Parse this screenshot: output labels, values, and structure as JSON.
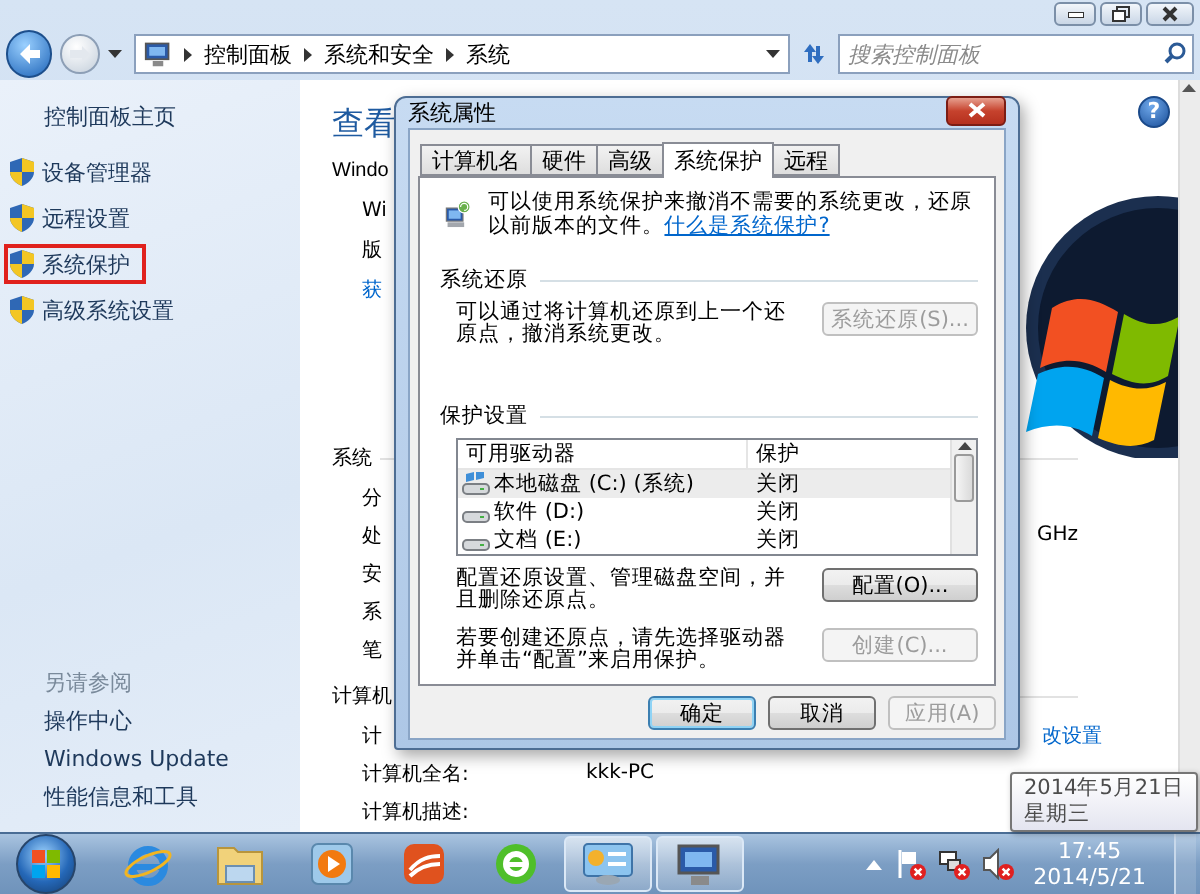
{
  "breadcrumb": [
    {
      "label": "控制面板"
    },
    {
      "label": "系统和安全"
    },
    {
      "label": "系统"
    }
  ],
  "search": {
    "placeholder": "搜索控制面板"
  },
  "left_pane": {
    "home": "控制面板主页",
    "tasks": [
      {
        "label": "设备管理器",
        "selected": false
      },
      {
        "label": "远程设置",
        "selected": false
      },
      {
        "label": "系统保护",
        "selected": true
      },
      {
        "label": "高级系统设置",
        "selected": false
      }
    ],
    "see_also": {
      "title": "另请参阅",
      "links": [
        "操作中心",
        "Windows Update",
        "性能信息和工具"
      ]
    }
  },
  "main": {
    "help": "?",
    "heading": "查看",
    "edition_title": "Windo",
    "edition_lines": [
      {
        "text": "Wi",
        "kind": "text"
      },
      {
        "text": "版",
        "kind": "text"
      },
      {
        "text": "获",
        "kind": "link"
      }
    ],
    "sections": [
      {
        "title": "系统",
        "rows": [
          {
            "label": "分"
          },
          {
            "label": "处",
            "trailing": "GHz"
          },
          {
            "label": "安"
          },
          {
            "label": "系"
          },
          {
            "label": "笔"
          }
        ]
      },
      {
        "title": "计算机",
        "rows": [
          {
            "label": "计",
            "link": "改设置"
          },
          {
            "label": "计算机全名:",
            "value": "kkk-PC"
          },
          {
            "label": "计算机描述:"
          }
        ]
      }
    ]
  },
  "dialog": {
    "title": "系统属性",
    "tabs": [
      {
        "label": "计算机名",
        "selected": false
      },
      {
        "label": "硬件",
        "selected": false
      },
      {
        "label": "高级",
        "selected": false
      },
      {
        "label": "系统保护",
        "selected": true
      },
      {
        "label": "远程",
        "selected": false
      }
    ],
    "intro": "可以使用系统保护来撤消不需要的系统更改，还原以前版本的文件。",
    "intro_link": "什么是系统保护?",
    "restore": {
      "title": "系统还原",
      "text": "可以通过将计算机还原到上一个还原点，撤消系统更改。",
      "button": {
        "label": "系统还原(S)...",
        "disabled": true
      }
    },
    "protection": {
      "title": "保护设置",
      "columns": [
        "可用驱动器",
        "保护"
      ],
      "drives": [
        {
          "name": "本地磁盘 (C:) (系统)",
          "protection": "关闭",
          "kind": "system",
          "selected": true
        },
        {
          "name": "软件 (D:)",
          "protection": "关闭",
          "kind": "disk",
          "selected": false
        },
        {
          "name": "文档 (E:)",
          "protection": "关闭",
          "kind": "disk",
          "selected": false
        }
      ],
      "configure": {
        "text": "配置还原设置、管理磁盘空间，并且删除还原点。",
        "button": {
          "label": "配置(O)...",
          "disabled": false
        }
      },
      "create": {
        "text": "若要创建还原点，请先选择驱动器并单击“配置”来启用保护。",
        "button": {
          "label": "创建(C)...",
          "disabled": true
        }
      }
    },
    "buttons": [
      {
        "label": "确定",
        "default": true,
        "disabled": false
      },
      {
        "label": "取消",
        "default": false,
        "disabled": false
      },
      {
        "label": "应用(A)",
        "default": false,
        "disabled": true
      }
    ]
  },
  "tooltip": {
    "lines": [
      "2014年5月21日",
      "星期三"
    ]
  },
  "taskbar": {
    "apps": [
      {
        "kind": "browser",
        "active": false
      },
      {
        "kind": "folder",
        "active": false
      },
      {
        "kind": "player",
        "active": false
      },
      {
        "kind": "app",
        "active": false
      },
      {
        "kind": "greenbrowser",
        "active": false
      },
      {
        "kind": "panel",
        "active": true
      },
      {
        "kind": "computer",
        "active": true
      }
    ],
    "clock": {
      "time": "17:45",
      "date": "2014/5/21"
    }
  }
}
